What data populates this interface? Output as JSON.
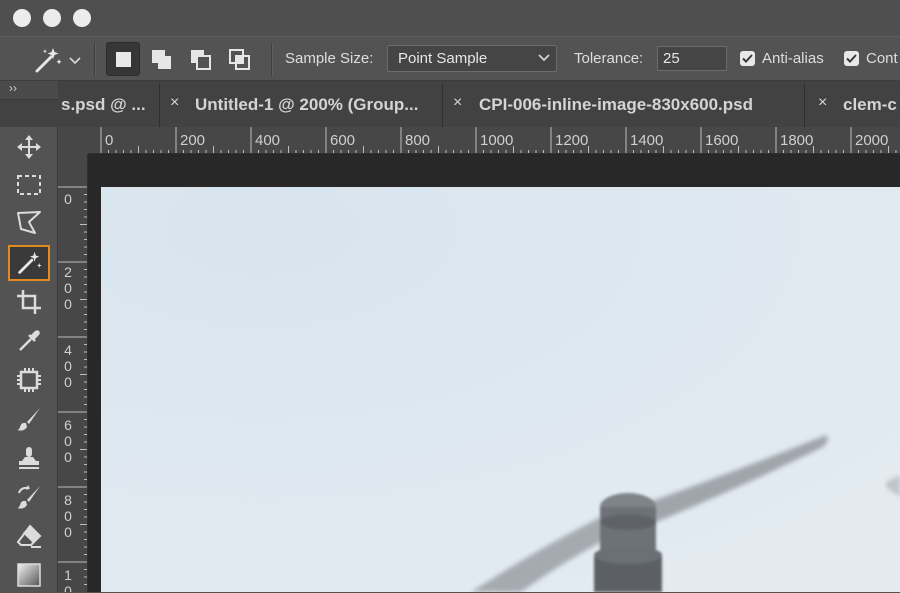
{
  "window": {
    "traffic_lights": [
      "close",
      "minimize",
      "zoom"
    ]
  },
  "options_bar": {
    "tool_icon": "magic-wand-icon",
    "selection_modes": [
      "new-selection",
      "add-to-selection",
      "subtract-from-selection",
      "intersect-with-selection"
    ],
    "sample_size_label": "Sample Size:",
    "sample_size_value": "Point Sample",
    "tolerance_label": "Tolerance:",
    "tolerance_value": "25",
    "anti_alias_label": "Anti-alias",
    "contiguous_label": "Cont"
  },
  "panel_expander": "››",
  "tabs": [
    {
      "title": "s.psd @ ..."
    },
    {
      "close": "×",
      "title": "Untitled-1 @ 200% (Group..."
    },
    {
      "close": "×",
      "title": "CPI-006-inline-image-830x600.psd"
    },
    {
      "close": "×",
      "title": "clem-c"
    }
  ],
  "tools": [
    {
      "name": "move-tool",
      "icon": "move-icon"
    },
    {
      "name": "marquee-tool",
      "icon": "marquee-icon"
    },
    {
      "name": "lasso-tool",
      "icon": "polygonal-lasso-icon"
    },
    {
      "name": "magic-wand-tool",
      "icon": "magic-wand-icon",
      "active": true
    },
    {
      "name": "crop-tool",
      "icon": "crop-icon"
    },
    {
      "name": "eyedropper-tool",
      "icon": "eyedropper-icon"
    },
    {
      "name": "patch-tool",
      "icon": "patch-icon"
    },
    {
      "name": "brush-tool",
      "icon": "brush-icon"
    },
    {
      "name": "stamp-tool",
      "icon": "clone-stamp-icon"
    },
    {
      "name": "history-brush-tool",
      "icon": "history-brush-icon"
    },
    {
      "name": "eraser-tool",
      "icon": "eraser-icon"
    },
    {
      "name": "gradient-tool",
      "icon": "gradient-icon"
    }
  ],
  "ruler_h": [
    "0",
    "200",
    "400",
    "600",
    "800",
    "1000",
    "1200",
    "1400",
    "1600",
    "1800",
    "2000"
  ],
  "ruler_v": [
    "0",
    "200",
    "400",
    "600",
    "800",
    "1"
  ],
  "colors": {
    "accent_active_tool": "#e08a20",
    "panel_bg": "#535353",
    "pasteboard": "#282828"
  }
}
